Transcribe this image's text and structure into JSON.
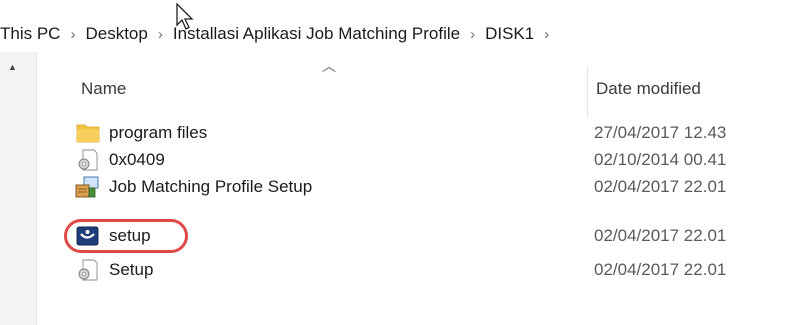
{
  "breadcrumb": {
    "items": [
      "This PC",
      "Desktop",
      "Installasi Aplikasi Job Matching Profile",
      "DISK1"
    ],
    "separator": "›"
  },
  "columns": {
    "name": "Name",
    "date_modified": "Date modified"
  },
  "files": [
    {
      "name": "program files",
      "date": "27/04/2017 12.43",
      "icon": "folder-icon"
    },
    {
      "name": "0x0409",
      "date": "02/10/2014 00.41",
      "icon": "settings-file-icon"
    },
    {
      "name": "Job Matching Profile Setup",
      "date": "02/04/2017 22.01",
      "icon": "installer-package-icon"
    },
    {
      "name": "setup",
      "date": "02/04/2017 22.01",
      "icon": "setup-app-icon"
    },
    {
      "name": "Setup",
      "date": "02/04/2017 22.01",
      "icon": "settings-file-icon"
    }
  ],
  "highlight": {
    "target": "setup",
    "color": "#e04848"
  },
  "colors": {
    "folder": "#f5c242",
    "text": "#1a1a1a",
    "date_text": "#5a5a5a"
  }
}
